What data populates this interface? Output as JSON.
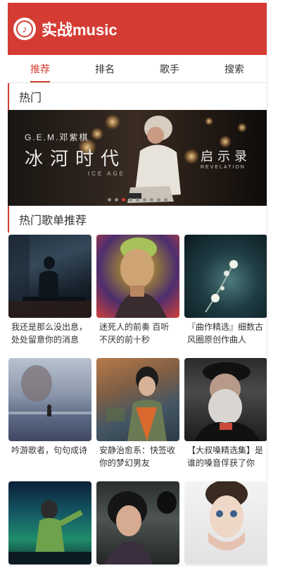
{
  "header": {
    "title": "实战music",
    "logo_icon": "music-note-icon"
  },
  "tabs": [
    {
      "label": "推荐",
      "active": true
    },
    {
      "label": "排名",
      "active": false
    },
    {
      "label": "歌手",
      "active": false
    },
    {
      "label": "搜索",
      "active": false
    }
  ],
  "sections": {
    "hot": "热门",
    "playlists": "热门歌单推荐"
  },
  "banner": {
    "left_small": "G.E.M.邓紫棋",
    "left_big": "冰河时代",
    "left_sub": "ICE AGE",
    "right_big": "启示录",
    "right_sub": "REVELATION",
    "dot_count": 9,
    "active_dot": 2
  },
  "playlists": [
    {
      "title": "我还是那么没出息，处处留意你的消息"
    },
    {
      "title": "迷死人的前奏 百听不厌的前十秒"
    },
    {
      "title": "『曲作精选』细数古风圈原创作曲人"
    },
    {
      "title": "吟游歌者，句句成诗"
    },
    {
      "title": "安静治愈系：快签收你的梦幻男友"
    },
    {
      "title": "【大叔嗓精选集】是谁的嗓音俘获了你"
    },
    {
      "title": ""
    },
    {
      "title": ""
    },
    {
      "title": ""
    }
  ],
  "colors": {
    "accent": "#d43c33"
  }
}
